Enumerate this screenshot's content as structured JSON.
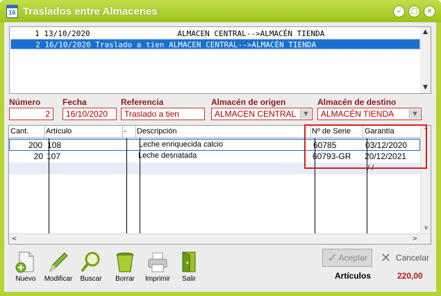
{
  "window": {
    "title": "Traslados entre Almacenes",
    "app_icon_text": "16"
  },
  "top_list": {
    "rows": [
      "     1 13/10/2020                   ALMACEN CENTRAL-->ALMACÉN TIENDA",
      "     2 16/10/2020 Traslado a tien ALMACEN CENTRAL-->ALMACÉN TIENDA"
    ],
    "selected_index": 1
  },
  "form": {
    "numero_label": "Número",
    "numero_value": "2",
    "fecha_label": "Fecha",
    "fecha_value": "16/10/2020",
    "referencia_label": "Referencia",
    "referencia_value": "Traslado a tien",
    "origen_label": "Almacén de origen",
    "origen_value": "ALMACEN CENTRAL",
    "destino_label": "Almacén de destino",
    "destino_value": "ALMACÉN TIENDA"
  },
  "grid": {
    "headers": {
      "cant": "Cant.",
      "articulo": "Artículo",
      "dash": "-",
      "descripcion": "Descripción",
      "serie": "Nº de Serie",
      "garantia": "Garantía"
    },
    "rows": [
      {
        "cant": "200",
        "articulo": "108",
        "descripcion": "Leche enriquecida calcio",
        "serie": "60785",
        "garantia": "03/12/2020"
      },
      {
        "cant": "20",
        "articulo": "107",
        "descripcion": "Leche desnatada",
        "serie": "60793-GR",
        "garantia": "20/12/2021"
      }
    ],
    "blank_row_garantia": "/ /"
  },
  "toolbar": {
    "nuevo": "Nuevo",
    "modificar": "Modificar",
    "buscar": "Buscar",
    "borrar": "Borrar",
    "imprimir": "Imprimir",
    "salir": "Salir"
  },
  "actions": {
    "aceptar": "Aceptar",
    "cancelar": "Cancelar"
  },
  "totals": {
    "label": "Artículos",
    "value": "220,00"
  },
  "colors": {
    "title_bar": "#b5d334",
    "selection": "#1b6fd1",
    "field_border": "#cc3333",
    "highlight_box": "#e01b1b"
  }
}
